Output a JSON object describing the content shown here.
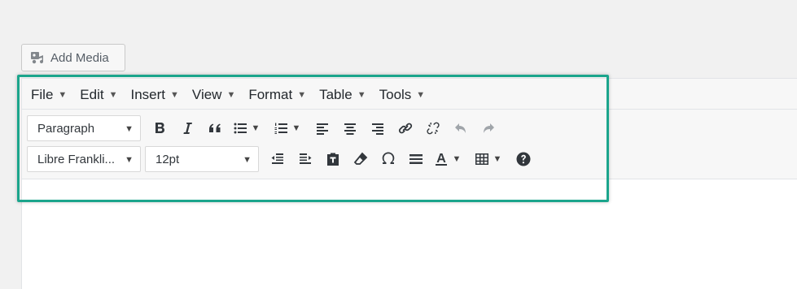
{
  "add_media": {
    "label": "Add Media",
    "icon": "add-media-icon"
  },
  "menubar": [
    {
      "label": "File"
    },
    {
      "label": "Edit"
    },
    {
      "label": "Insert"
    },
    {
      "label": "View"
    },
    {
      "label": "Format"
    },
    {
      "label": "Table"
    },
    {
      "label": "Tools"
    }
  ],
  "toolbar": {
    "format_select": "Paragraph",
    "font_select": "Libre Frankli...",
    "size_select": "12pt",
    "row1_icons": [
      "bold-icon",
      "italic-icon",
      "blockquote-icon",
      "bullet-list-icon",
      "numbered-list-icon",
      "align-left-icon",
      "align-center-icon",
      "align-right-icon",
      "link-icon",
      "unlink-icon",
      "undo-icon",
      "redo-icon"
    ],
    "row2_icons": [
      "outdent-icon",
      "indent-icon",
      "paste-text-icon",
      "clear-formatting-icon",
      "special-character-icon",
      "horizontal-line-icon",
      "text-color-icon",
      "table-icon",
      "help-icon"
    ]
  },
  "colors": {
    "highlight": "#1ba58c",
    "background": "#f1f1f1"
  }
}
